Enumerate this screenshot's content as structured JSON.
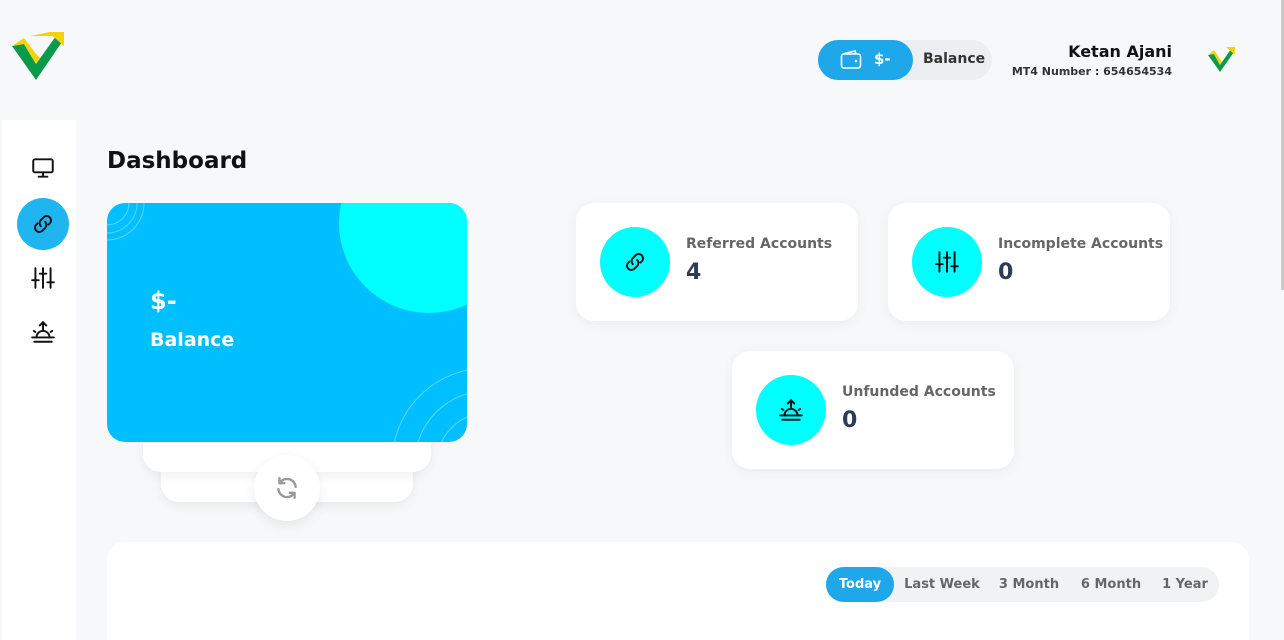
{
  "header": {
    "balance_amount": "$-",
    "balance_label": "Balance",
    "user_name": "Ketan Ajani",
    "mt4_label": "MT4 Number : 654654534"
  },
  "sidebar": {
    "items": [
      {
        "name": "dashboard",
        "icon": "monitor-icon",
        "active": false
      },
      {
        "name": "referral",
        "icon": "link-icon",
        "active": true
      },
      {
        "name": "settings",
        "icon": "sliders-icon",
        "active": false
      },
      {
        "name": "unfunded",
        "icon": "sunrise-icon",
        "active": false
      }
    ]
  },
  "main": {
    "title": "Dashboard",
    "balance_card": {
      "amount": "$-",
      "label": "Balance"
    },
    "stats": [
      {
        "title": "Referred Accounts",
        "value": "4",
        "icon": "link-icon"
      },
      {
        "title": "Incomplete Accounts",
        "value": "0",
        "icon": "sliders-icon"
      },
      {
        "title": "Unfunded Accounts",
        "value": "0",
        "icon": "sunrise-icon"
      }
    ],
    "range_tabs": [
      {
        "label": "Today",
        "active": true
      },
      {
        "label": "Last Week",
        "active": false
      },
      {
        "label": "3 Month",
        "active": false
      },
      {
        "label": "6 Month",
        "active": false
      },
      {
        "label": "1 Year",
        "active": false
      }
    ]
  },
  "colors": {
    "accent": "#1ea7e9",
    "card_blue": "#00bfff",
    "cyan": "#00ffff",
    "value_text": "#2d3a5c"
  }
}
